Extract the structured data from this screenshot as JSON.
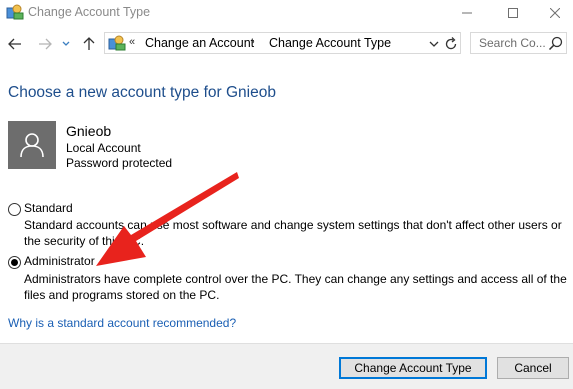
{
  "window": {
    "title": "Change Account Type",
    "minimize_glyph": "—",
    "maximize_glyph": "☐",
    "close_glyph": "✕"
  },
  "nav": {
    "breadcrumb_chevron": "«",
    "breadcrumb": [
      "Change an Account",
      "Change Account Type"
    ],
    "breadcrumb_separator": "›",
    "search_placeholder": "Search Co..."
  },
  "page": {
    "heading": "Choose a new account type for Gnieob",
    "user": {
      "name": "Gnieob",
      "type": "Local Account",
      "status": "Password protected"
    },
    "options": [
      {
        "label": "Standard",
        "description": "Standard accounts can use most software and change system settings that don't affect other users or the security of this PC.",
        "selected": false
      },
      {
        "label": "Administrator",
        "description": "Administrators have complete control over the PC. They can change any settings and access all of the files and programs stored on the PC.",
        "selected": true
      }
    ],
    "help_link": "Why is a standard account recommended?"
  },
  "footer": {
    "primary_button": "Change Account Type",
    "cancel_button": "Cancel"
  },
  "colors": {
    "heading": "#1e4e8c",
    "link": "#1a5fb4",
    "annotation_arrow": "#e8231d",
    "avatar_bg": "#6d6d6d"
  },
  "icons": [
    "control-panel-icon",
    "back-arrow-icon",
    "forward-arrow-icon",
    "recent-chevron-icon",
    "up-arrow-icon",
    "dropdown-chevron-icon",
    "refresh-icon",
    "search-icon",
    "user-avatar-icon"
  ]
}
